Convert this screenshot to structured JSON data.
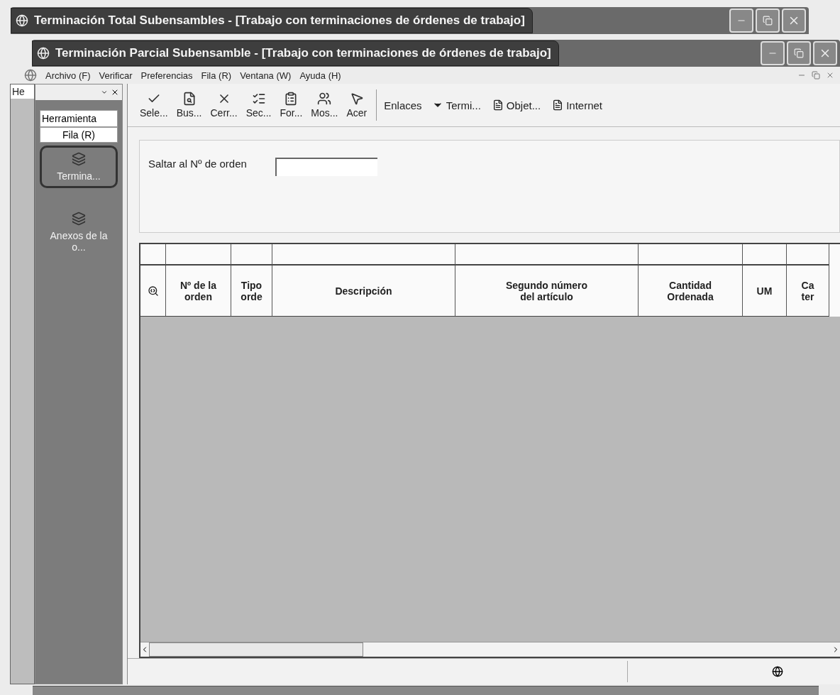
{
  "windows": [
    {
      "title": "Terminación Total Subensambles - [Trabajo con terminaciones de órdenes de trabajo]"
    },
    {
      "title": "Terminación Parcial Subensamble - [Trabajo con terminaciones de órdenes de trabajo]"
    }
  ],
  "menu": [
    "Archivo (F)",
    "Verificar",
    "Preferencias",
    "Fila (R)",
    "Ventana (W)",
    "Ayuda (H)"
  ],
  "side_label": "He",
  "sidebar": {
    "title": "Herramienta",
    "section": "Fila (R)",
    "items": [
      {
        "label": "Termina...",
        "selected": true
      },
      {
        "label": "Anexos de la o...",
        "selected": false
      }
    ]
  },
  "toolbar": [
    {
      "label": "Sele...",
      "kind": "check"
    },
    {
      "label": "Bus...",
      "kind": "search"
    },
    {
      "label": "Cerr...",
      "kind": "close"
    },
    {
      "label": "Sec...",
      "kind": "list"
    },
    {
      "label": "For...",
      "kind": "form"
    },
    {
      "label": "Mos...",
      "kind": "people"
    },
    {
      "label": "Acer",
      "kind": "help"
    }
  ],
  "links_label": "Enlaces",
  "links": [
    {
      "label": "Termi...",
      "kind": "dropdown"
    },
    {
      "label": "Objet...",
      "kind": "doc"
    },
    {
      "label": "Internet",
      "kind": "doc"
    }
  ],
  "jump": {
    "label": "Saltar al Nº de orden"
  },
  "table": {
    "columns": [
      {
        "kind": "icon"
      },
      {
        "label": "Nº de la orden"
      },
      {
        "label": "Tipo orde"
      },
      {
        "label": "Descripción"
      },
      {
        "label": "Segundo número del artículo"
      },
      {
        "label": "Cantidad Ordenada"
      },
      {
        "label": "UM"
      },
      {
        "label": "Ca ter"
      }
    ]
  }
}
